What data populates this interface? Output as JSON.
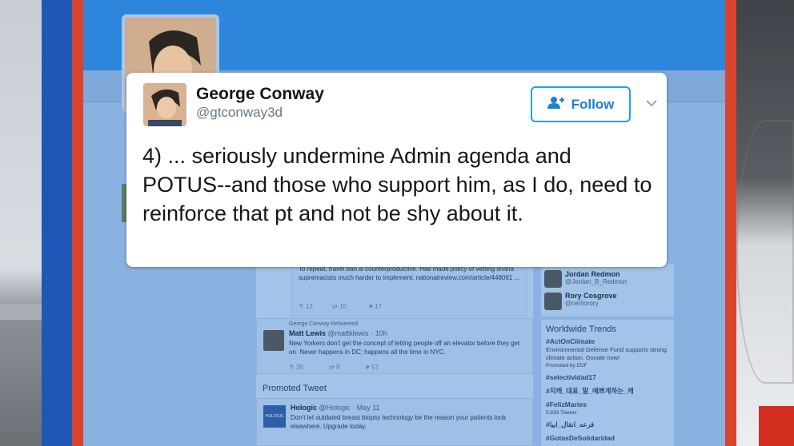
{
  "tweet": {
    "name": "George Conway",
    "handle": "@gtconway3d",
    "follow_label": "Follow",
    "text": "4) ... seriously undermine Admin agenda and POTUS--and those who support him, as I do, need to reinforce that pt and not be shy about it."
  },
  "feed": {
    "tweet1": {
      "body": "To repeat, travel ban is counterproductive. Has made policy of vetting sharia supremacists much harder to implement. nationalreview.com/article/448061 ...",
      "replies": "12",
      "retweets": "10",
      "likes": "17"
    },
    "tweet2": {
      "retweeted_by": "George Conway Retweeted",
      "name": "Matt Lewis",
      "handle": "@mattklewis",
      "time": "· 10h",
      "body": "New Yorkers don't get the concept of letting people off an elevator before they get on. Never happens in DC; happens all the time in NYC.",
      "replies": "26",
      "retweets": "8",
      "likes": "57"
    },
    "promoted_label": "Promoted Tweet",
    "tweet3": {
      "avatar_text": "HOLOGIC",
      "name": "Hologic",
      "handle": "@Hologic",
      "time": "· May 11",
      "body": "Don't let outdated breast biopsy technology be the reason your patients look elsewhere. Upgrade today."
    }
  },
  "who_to_follow": [
    {
      "name": "Jordan Redmon",
      "handle": "@Jordan_B_Redmon"
    },
    {
      "name": "Rory Cosgrove",
      "handle": "@certiorory"
    }
  ],
  "trends": {
    "title": "Worldwide Trends",
    "items": [
      {
        "tag": "#ActOnClimate",
        "sub": "Environmental Defense Fund supports strong climate action. Donate now!",
        "promoted": "Promoted by EDF"
      },
      {
        "tag": "#selectividad17",
        "sub": "",
        "promoted": ""
      },
      {
        "tag": "#지캐_대표_말_예쁘게하는_캐",
        "sub": "",
        "promoted": ""
      },
      {
        "tag": "#FelizMartes",
        "sub": "5,633 Tweets",
        "promoted": ""
      },
      {
        "tag": "#قرعه_انقال_ابيا",
        "sub": "",
        "promoted": ""
      },
      {
        "tag": "#GotasDeSolidaridad",
        "sub": "",
        "promoted": ""
      }
    ]
  },
  "colors": {
    "twitter_blue": "#1da1f2",
    "frame_blue": "#1f57b8",
    "frame_red": "#d9442e"
  },
  "icons": {
    "follow": "add-user-icon",
    "menu": "chevron-down-icon"
  }
}
